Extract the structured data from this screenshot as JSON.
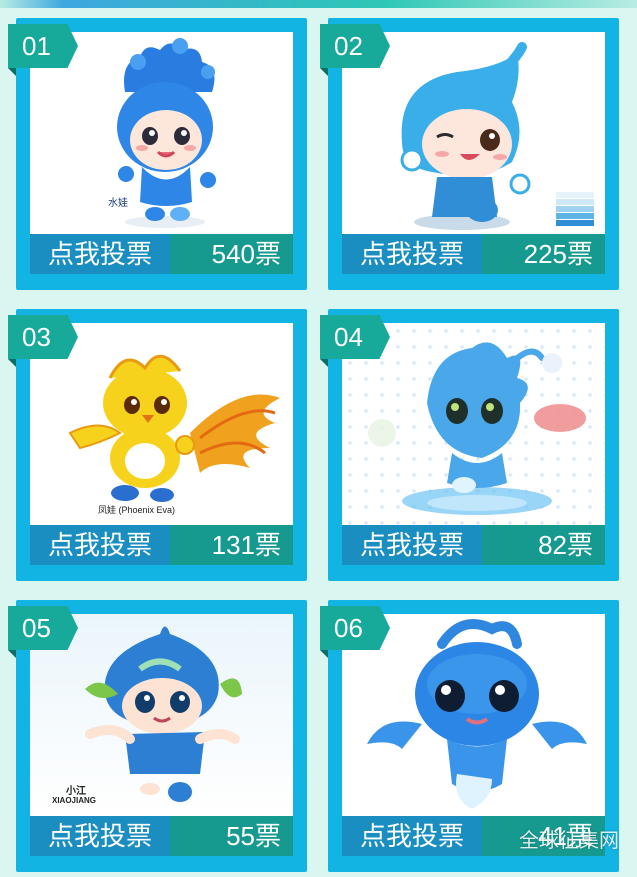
{
  "entries": [
    {
      "num": "01",
      "vote_label": "点我投票",
      "votes": "540票",
      "image_caption": "水娃",
      "mascot": "water-drop-girl-mascot"
    },
    {
      "num": "02",
      "vote_label": "点我投票",
      "votes": "225票",
      "image_caption": "",
      "mascot": "water-drop-winking-mascot"
    },
    {
      "num": "03",
      "vote_label": "点我投票",
      "votes": "131票",
      "image_caption": "凤娃 (Phoenix Eva)",
      "mascot": "phoenix-bird-mascot"
    },
    {
      "num": "04",
      "vote_label": "点我投票",
      "votes": "82票",
      "image_caption": "",
      "mascot": "splash-water-creature-mascot"
    },
    {
      "num": "05",
      "vote_label": "点我投票",
      "votes": "55票",
      "image_caption": "小江",
      "image_caption_en": "XIAOJIANG",
      "mascot": "leaf-water-drop-girl-mascot"
    },
    {
      "num": "06",
      "vote_label": "点我投票",
      "votes": "41票",
      "image_caption": "",
      "mascot": "blue-water-sprite-mascot"
    }
  ],
  "watermark": "全球征集网",
  "colors": {
    "page_bg": "#d9f7f0",
    "card_frame": "#12b4e3",
    "number_tab": "#17a99a",
    "vote_button": "#1a8ec0",
    "vote_count": "#169a90"
  }
}
